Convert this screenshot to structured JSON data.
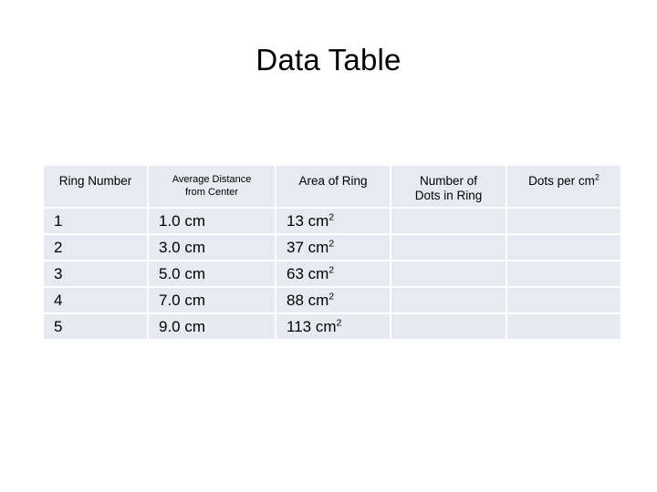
{
  "slide": {
    "title": "Data Table",
    "background_color": "#ffffff",
    "cell_fill_color": "#e7eaf0",
    "text_color": "#000000"
  },
  "table": {
    "columns": [
      {
        "label": "Ring Number",
        "lines": [
          "Ring Number"
        ],
        "style": "normal"
      },
      {
        "label": "Average Distance from Center",
        "lines": [
          "Average Distance",
          "from Center"
        ],
        "style": "small"
      },
      {
        "label": "Area of Ring",
        "lines": [
          "Area of Ring"
        ],
        "style": "normal"
      },
      {
        "label": "Number of Dots in Ring",
        "lines": [
          "Number of",
          "Dots in Ring"
        ],
        "style": "normal"
      },
      {
        "label": "Dots per cm2",
        "lines": [
          "Dots per cm",
          "2"
        ],
        "style": "superscript"
      }
    ],
    "rows": [
      {
        "ring_number": "1",
        "average_distance": "1.0 cm",
        "area_value": "13 cm",
        "area_exponent": "2",
        "number_of_dots": "",
        "dots_per_cm2": ""
      },
      {
        "ring_number": "2",
        "average_distance": "3.0 cm",
        "area_value": "37 cm",
        "area_exponent": "2",
        "number_of_dots": "",
        "dots_per_cm2": ""
      },
      {
        "ring_number": "3",
        "average_distance": "5.0 cm",
        "area_value": "63 cm",
        "area_exponent": "2",
        "number_of_dots": "",
        "dots_per_cm2": ""
      },
      {
        "ring_number": "4",
        "average_distance": "7.0 cm",
        "area_value": "88 cm",
        "area_exponent": "2",
        "number_of_dots": "",
        "dots_per_cm2": ""
      },
      {
        "ring_number": "5",
        "average_distance": "9.0 cm",
        "area_value": "113 cm",
        "area_exponent": "2",
        "number_of_dots": "",
        "dots_per_cm2": ""
      }
    ]
  }
}
